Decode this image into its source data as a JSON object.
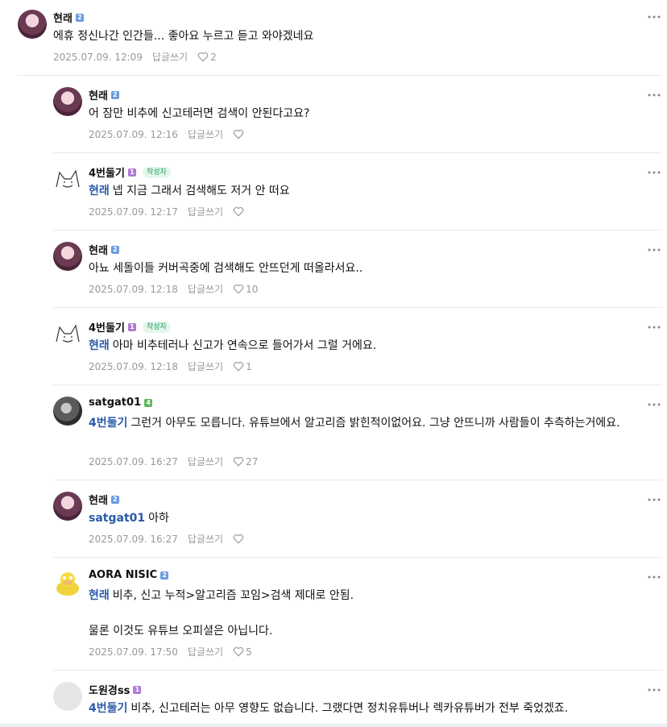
{
  "comments": [
    {
      "name": "현래",
      "level": "2",
      "level_color": "#6a9be0",
      "author_badge": "",
      "mention": "",
      "text": "에휴 정신나간 인간들... 좋아요 누르고 듣고 와야겠네요",
      "date": "2025.07.09. 12:09",
      "reply": "답글쓰기",
      "likes": "2",
      "avatar": "purple"
    },
    {
      "name": "현래",
      "level": "2",
      "level_color": "#6a9be0",
      "author_badge": "",
      "mention": "",
      "text": "어 잠만 비추에 신고테러면 검색이 안된다고요?",
      "date": "2025.07.09. 12:16",
      "reply": "답글쓰기",
      "likes": "",
      "avatar": "purple"
    },
    {
      "name": "4번둘기",
      "level": "1",
      "level_color": "#b27ad6",
      "author_badge": "작성자",
      "mention": "현래",
      "text": "넵 지금 그래서 검색해도 저거 안 떠요",
      "date": "2025.07.09. 12:17",
      "reply": "답글쓰기",
      "likes": "",
      "avatar": "dog"
    },
    {
      "name": "현래",
      "level": "2",
      "level_color": "#6a9be0",
      "author_badge": "",
      "mention": "",
      "text": "아뇨 세돌이들 커버곡중에 검색해도 안뜨던게 떠올라서요..",
      "date": "2025.07.09. 12:18",
      "reply": "답글쓰기",
      "likes": "10",
      "avatar": "purple"
    },
    {
      "name": "4번둘기",
      "level": "1",
      "level_color": "#b27ad6",
      "author_badge": "작성자",
      "mention": "현래",
      "text": "아마 비추테러나 신고가 연속으로 들어가서 그럴 거에요.",
      "date": "2025.07.09. 12:18",
      "reply": "답글쓰기",
      "likes": "1",
      "avatar": "dog"
    },
    {
      "name": "satgat01",
      "level": "4",
      "level_color": "#5db85d",
      "author_badge": "",
      "mention": "4번둘기",
      "text": "그런거 아무도 모릅니다. 유튜브에서 알고리즘 밝힌적이없어요. 그냥 안뜨니까 사람들이 추측하는거에요.",
      "date": "2025.07.09. 16:27",
      "reply": "답글쓰기",
      "likes": "27",
      "avatar": "sat"
    },
    {
      "name": "현래",
      "level": "2",
      "level_color": "#6a9be0",
      "author_badge": "",
      "mention": "satgat01",
      "text": "아하",
      "date": "2025.07.09. 16:27",
      "reply": "답글쓰기",
      "likes": "",
      "avatar": "purple"
    },
    {
      "name": "AORA NISIC",
      "level": "2",
      "level_color": "#6a9be0",
      "author_badge": "",
      "mention": "현래",
      "text": "비추, 신고 누적>알고리즘 꼬임>검색 제대로 안됨.",
      "text2": "물론 이것도 유튜브 오피셜은 아닙니다.",
      "date": "2025.07.09. 17:50",
      "reply": "답글쓰기",
      "likes": "5",
      "avatar": "duck"
    },
    {
      "name": "도원경ss",
      "level": "1",
      "level_color": "#b27ad6",
      "author_badge": "",
      "mention": "4번둘기",
      "text": "비추, 신고테러는 아무 영향도 없습니다. 그랬다면 정치유튜버나 렉카유튜버가 전부 죽었겠죠.",
      "date": "",
      "reply": "",
      "likes": "",
      "avatar": "blank"
    }
  ]
}
